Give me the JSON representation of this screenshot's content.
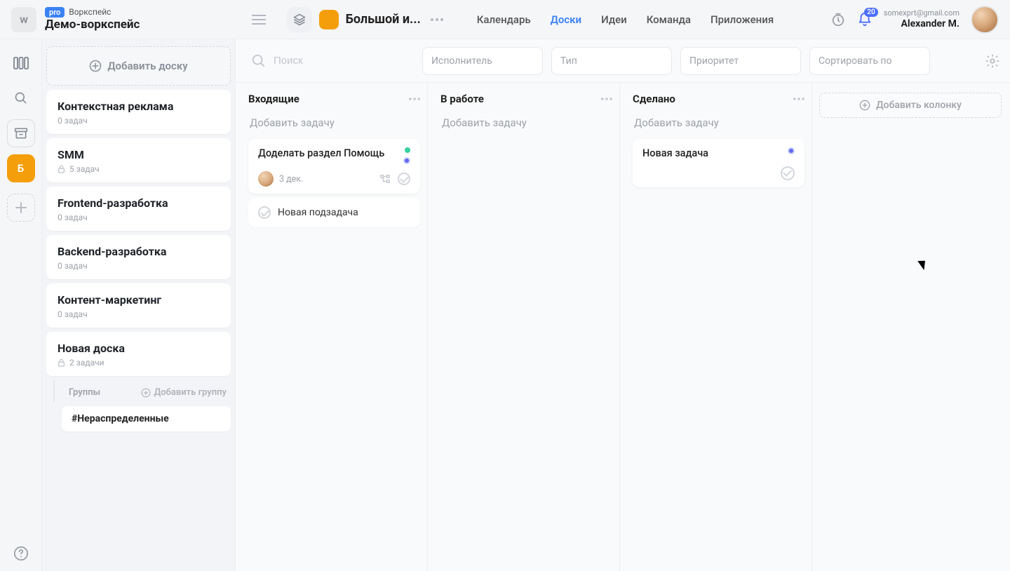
{
  "workspace": {
    "avatar_letter": "w",
    "badge": "pro",
    "label": "Воркспейс",
    "name": "Демо-воркспейс"
  },
  "project": {
    "name": "Большой и...",
    "color": "#f59e0b"
  },
  "nav": {
    "calendar": "Календарь",
    "boards": "Доски",
    "ideas": "Идеи",
    "team": "Команда",
    "apps": "Приложения"
  },
  "header": {
    "notif_count": "20",
    "user_email": "somexprt@gmail.com",
    "user_name": "Alexander M."
  },
  "rail": {
    "project_letter": "Б"
  },
  "sidebar": {
    "add_board": "Добавить доску",
    "boards": [
      {
        "title": "Контекстная реклама",
        "sub": "0 задач",
        "lock": false
      },
      {
        "title": "SMM",
        "sub": "5 задач",
        "lock": true
      },
      {
        "title": "Frontend-разработка",
        "sub": "0 задач",
        "lock": false
      },
      {
        "title": "Backend-разработка",
        "sub": "0 задач",
        "lock": false
      },
      {
        "title": "Контент-маркетинг",
        "sub": "0 задач",
        "lock": false
      },
      {
        "title": "Новая доска",
        "sub": "2 задачи",
        "lock": true
      }
    ],
    "groups_label": "Группы",
    "add_group": "Добавить группу",
    "group_0": "#Нераспределенные"
  },
  "filters": {
    "search_placeholder": "Поиск",
    "assignee": "Исполнитель",
    "type": "Тип",
    "priority": "Приоритет",
    "sort": "Сортировать по"
  },
  "columns": {
    "inbox": "Входящие",
    "doing": "В работе",
    "done": "Сделано",
    "add_task": "Добавить задачу",
    "add_column": "Добавить колонку"
  },
  "tasks": {
    "t1_title": "Доделать раздел Помощь",
    "t1_date": "3 дек.",
    "t1_sub": "Новая подзадача",
    "t2_title": "Новая задача"
  }
}
